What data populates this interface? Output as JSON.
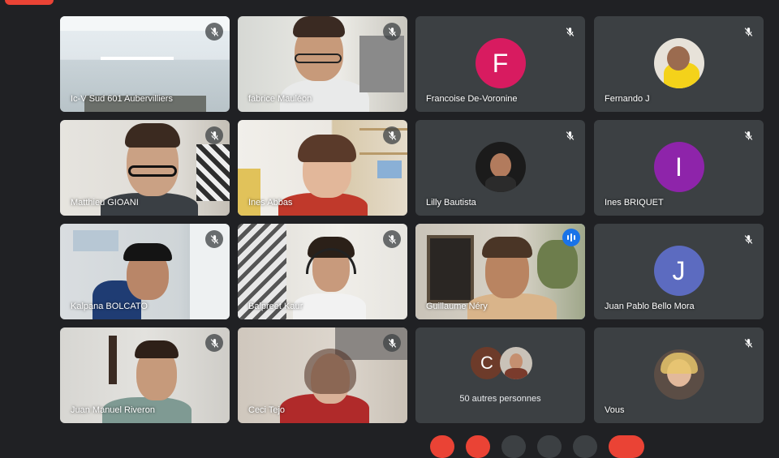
{
  "colors": {
    "background": "#202124",
    "tile": "#3c4043",
    "accent": "#1a73e8",
    "danger": "#ea4335"
  },
  "participants": [
    {
      "name": "Ic-V Sud 601 Aubervilliers",
      "type": "video",
      "muted": true
    },
    {
      "name": "fabrice Mauléon",
      "type": "video",
      "muted": true
    },
    {
      "name": "Francoise De-Voronine",
      "type": "initial",
      "initial": "F",
      "color": "#d81b60",
      "muted": true
    },
    {
      "name": "Fernando J",
      "type": "photo",
      "muted": true
    },
    {
      "name": "Matthieu GIOANI",
      "type": "video",
      "muted": true
    },
    {
      "name": "Ines Abbas",
      "type": "video",
      "muted": true
    },
    {
      "name": "Lilly Bautista",
      "type": "photo",
      "muted": true
    },
    {
      "name": "Ines BRIQUET",
      "type": "initial",
      "initial": "I",
      "color": "#8e24aa",
      "muted": true
    },
    {
      "name": "Kalpana BOLCATO",
      "type": "video",
      "muted": true
    },
    {
      "name": "Balpreet Kaur",
      "type": "video",
      "muted": true
    },
    {
      "name": "Guillaume Néry",
      "type": "video",
      "speaking": true
    },
    {
      "name": "Juan Pablo Bello Mora",
      "type": "initial",
      "initial": "J",
      "color": "#5c6bc0",
      "muted": true
    },
    {
      "name": "Juan Manuel Riveron",
      "type": "video",
      "muted": true
    },
    {
      "name": "Ceci Tejo",
      "type": "video",
      "muted": true
    },
    {
      "name": "",
      "type": "more"
    },
    {
      "name": "Vous",
      "type": "photo",
      "muted": true
    }
  ],
  "more": {
    "initial": "C",
    "label": "50 autres personnes"
  },
  "icons": {
    "muted": "mic-off-icon",
    "speaking": "speaking-indicator-icon"
  }
}
